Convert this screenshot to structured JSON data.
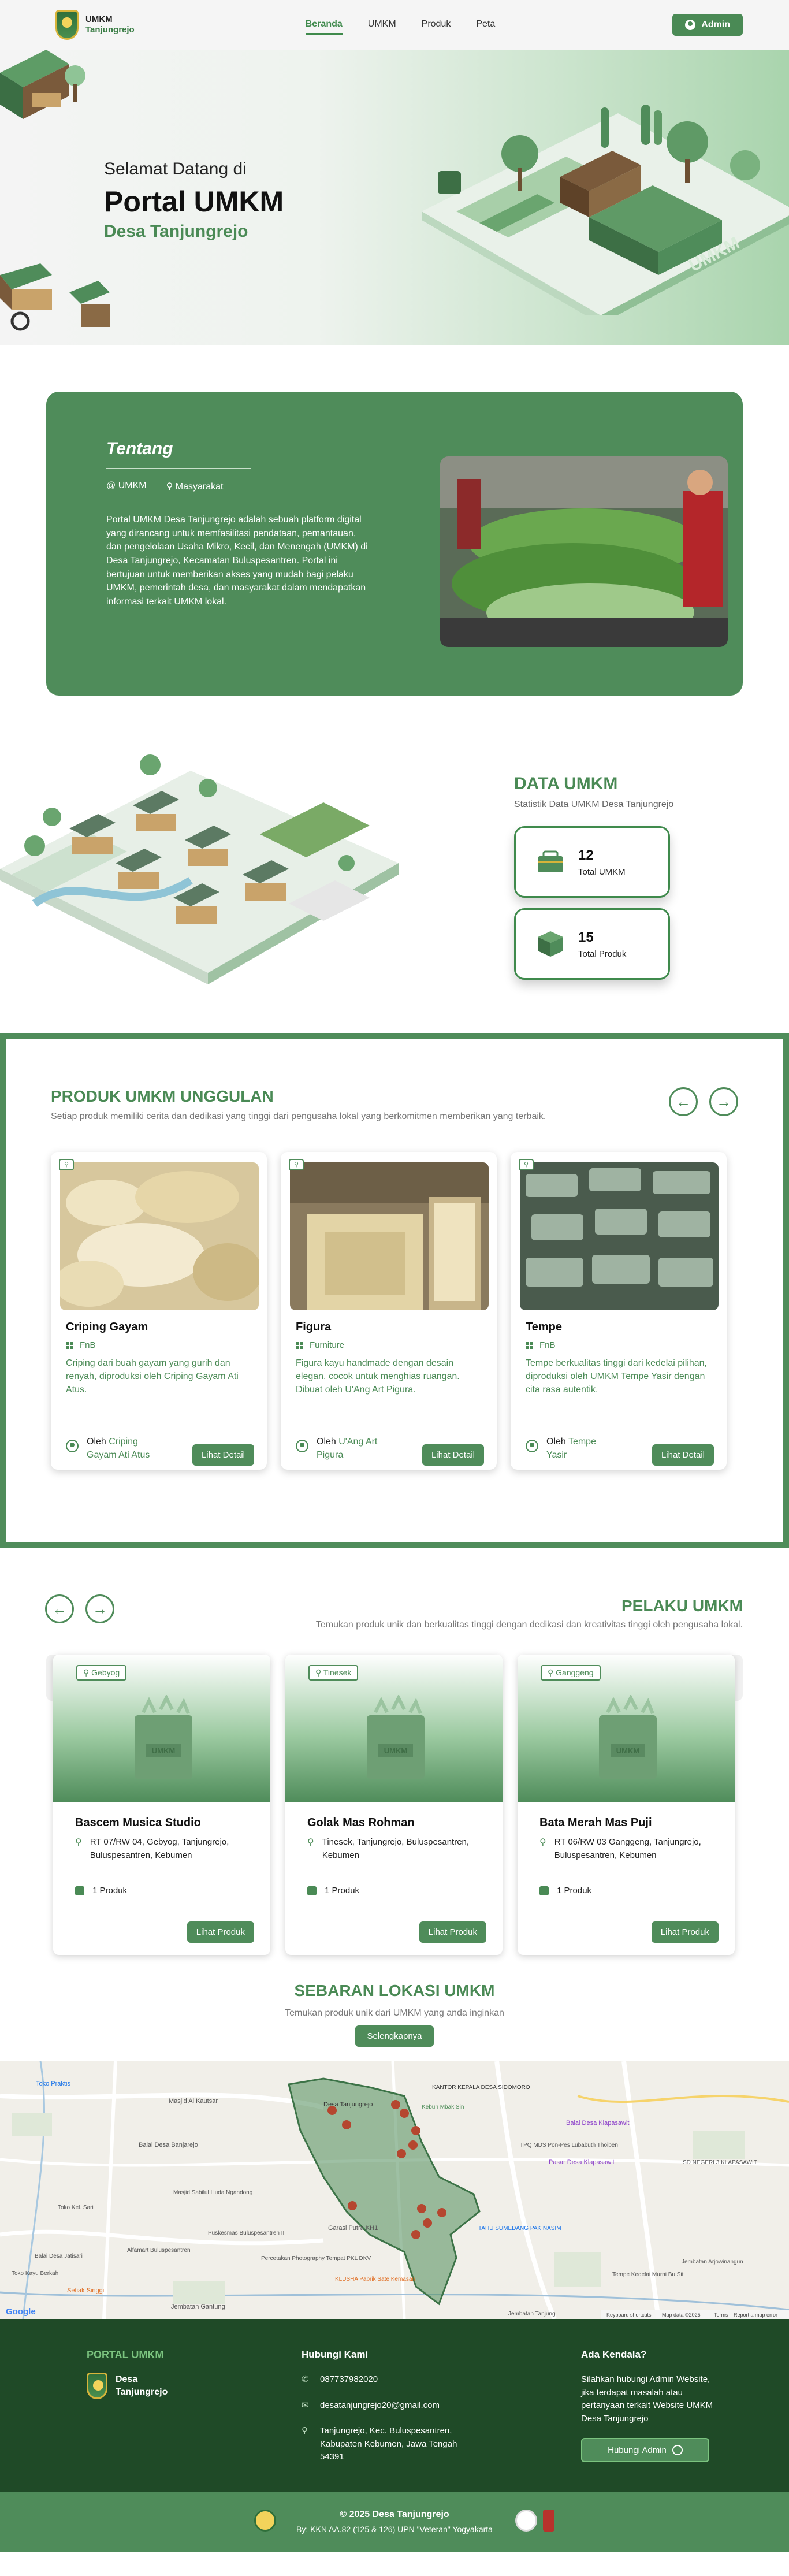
{
  "header": {
    "brand_line1": "UMKM",
    "brand_line2": "Tanjungrejo",
    "nav": [
      "Beranda",
      "UMKM",
      "Produk",
      "Peta"
    ],
    "admin_label": "Admin"
  },
  "hero": {
    "welcome": "Selamat Datang di",
    "title": "Portal UMKM",
    "subtitle": "Desa Tanjungrejo"
  },
  "about": {
    "title": "Tentang",
    "tag1": "@ UMKM",
    "tag2": "Masyarakat",
    "text": "Portal UMKM Desa Tanjungrejo adalah sebuah platform digital yang dirancang untuk memfasilitasi pendataan, pemantauan, dan pengelolaan Usaha Mikro, Kecil, dan Menengah (UMKM) di Desa Tanjungrejo, Kecamatan Buluspesantren. Portal ini bertujuan untuk memberikan akses yang mudah bagi pelaku UMKM, pemerintah desa, dan masyarakat dalam mendapatkan informasi terkait UMKM lokal."
  },
  "data_umkm": {
    "title": "DATA UMKM",
    "subtitle": "Statistik Data UMKM Desa Tanjungrejo",
    "stats": [
      {
        "value": "12",
        "label": "Total UMKM"
      },
      {
        "value": "15",
        "label": "Total Produk"
      }
    ]
  },
  "featured": {
    "title": "PRODUK UMKM UNGGULAN",
    "subtitle": "Setiap produk memiliki cerita dan dedikasi yang tinggi dari pengusaha lokal yang berkomitmen memberikan yang terbaik.",
    "owner_prefix": "Oleh",
    "button": "Lihat Detail",
    "products": [
      {
        "name": "Criping Gayam",
        "category": "FnB",
        "description": "Criping dari buah gayam yang gurih dan renyah, diproduksi oleh Criping Gayam Ati Atus.",
        "owner": "Criping Gayam Ati Atus"
      },
      {
        "name": "Figura",
        "category": "Furniture",
        "description": "Figura kayu handmade dengan desain elegan, cocok untuk menghias ruangan. Dibuat oleh U'Ang Art Pigura.",
        "owner": "U'Ang Art Pigura"
      },
      {
        "name": "Tempe",
        "category": "FnB",
        "description": "Tempe berkualitas tinggi dari kedelai pilihan, diproduksi oleh UMKM Tempe Yasir dengan cita rasa autentik.",
        "owner": "Tempe Yasir"
      }
    ]
  },
  "pelaku": {
    "title": "PELAKU UMKM",
    "subtitle": "Temukan produk unik dan berkualitas tinggi dengan dedikasi dan kreativitas tinggi oleh pengusaha lokal.",
    "button": "Lihat Produk",
    "bag_label": "UMKM",
    "items": [
      {
        "location": "Gebyog",
        "name": "Bascem Musica Studio",
        "address": "RT 07/RW 04, Gebyog, Tanjungrejo, Buluspesantren, Kebumen",
        "count": "1 Produk"
      },
      {
        "location": "Tinesek",
        "name": "Golak Mas Rohman",
        "address": "Tinesek, Tanjungrejo, Buluspesantren, Kebumen",
        "count": "1 Produk"
      },
      {
        "location": "Ganggeng",
        "name": "Bata Merah Mas Puji",
        "address": "RT 06/RW 03 Ganggeng, Tanjungrejo, Buluspesantren, Kebumen",
        "count": "1 Produk"
      }
    ]
  },
  "sebaran": {
    "title": "SEBARAN LOKASI UMKM",
    "subtitle": "Temukan produk unik dari UMKM yang anda inginkan",
    "button": "Selengkapnya"
  },
  "map": {
    "labels": [
      "Toko Praktis",
      "Masjid Al Kautsar",
      "Balai Desa Banjarejo",
      "Desa Tanjungrejo",
      "KANTOR KEPALA DESA SIDOMORO",
      "Balai Desa Klapasawit",
      "TPQ MDS Pon-Pes Lubabuth Thoiben",
      "Pasar Desa Klapasawit",
      "SD NEGERI 3 KLAPASAWIT",
      "Garasi Putra KH1",
      "TAHU SUMEDANG PAK NASIM",
      "Percetakan Photography Tempat PKL DKV",
      "KLUSHA Pabrik Sate Kemasan",
      "Tempe Kedelai Murni Bu Siti",
      "Jembatan Arjowinangun",
      "Setiak Singgil",
      "Jembatan Gantung",
      "Puskesmas Buluspesantren II",
      "Alfamart Buluspesantren",
      "Balai Desa Jatisari",
      "Toko Kayu Berkah",
      "Toko Kel. Sari",
      "Jembatan Tanjung",
      "Masjid Sabilul Huda Ngandong",
      "Kebun Mbak Sin"
    ],
    "google": "Google",
    "attribution": [
      "Keyboard shortcuts",
      "Map data ©2025",
      "Terms",
      "Report a map error"
    ]
  },
  "footer": {
    "portal_title": "PORTAL UMKM",
    "logo_line1": "Desa",
    "logo_line2": "Tanjungrejo",
    "contact_title": "Hubungi Kami",
    "phone": "087737982020",
    "email": "desatanjungrejo20@gmail.com",
    "address": "Tanjungrejo, Kec. Buluspesantren, Kabupaten Kebumen, Jawa Tengah 54391",
    "help_title": "Ada Kendala?",
    "help_text": "Silahkan hubungi Admin Website, jika terdapat masalah atau pertanyaan terkait Website UMKM Desa Tanjungrejo",
    "help_button": "Hubungi Admin",
    "copyright": "© 2025 Desa Tanjungrejo",
    "credit": "By: KKN AA.82 (125 & 126) UPN \"Veteran\" Yogyakarta"
  },
  "colors": {
    "primary": "#4f8c5a",
    "dark": "#1f4a27",
    "accent": "#7bc47f"
  }
}
